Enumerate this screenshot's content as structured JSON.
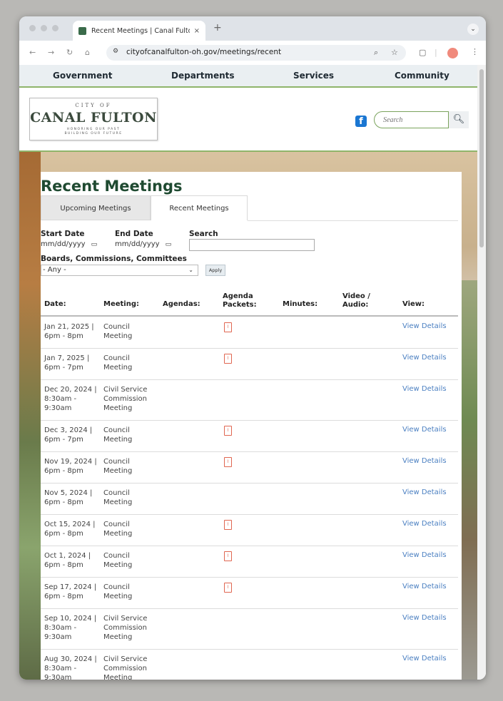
{
  "browser": {
    "tab_title": "Recent Meetings | Canal Fulton",
    "tab_close": "×",
    "new_tab": "+",
    "url": "cityofcanalfulton-oh.gov/meetings/recent"
  },
  "site_nav": {
    "items": [
      "Government",
      "Departments",
      "Services",
      "Community"
    ]
  },
  "header": {
    "logo_top": "CITY OF",
    "logo_name": "CANAL FULTON",
    "logo_tag_1": "HONORING OUR PAST",
    "logo_tag_2": "BUILDING OUR FUTURE",
    "search_placeholder": "Search"
  },
  "page": {
    "title": "Recent Meetings",
    "tabs": [
      {
        "label": "Upcoming Meetings",
        "active": false
      },
      {
        "label": "Recent Meetings",
        "active": true
      }
    ]
  },
  "filters": {
    "start_label": "Start Date",
    "end_label": "End Date",
    "search_label": "Search",
    "date_placeholder": "mm/dd/yyyy",
    "boards_label": "Boards, Commissions, Committees",
    "boards_value": "- Any -",
    "apply_label": "Apply"
  },
  "table": {
    "columns": [
      "Date:",
      "Meeting:",
      "Agendas:",
      "Agenda Packets:",
      "Minutes:",
      "Video / Audio:",
      "View:"
    ],
    "view_label": "View Details",
    "rows": [
      {
        "date": "Jan 21, 2025 | 6pm - 8pm",
        "meeting": "Council Meeting",
        "packet": true
      },
      {
        "date": "Jan 7, 2025 | 6pm - 7pm",
        "meeting": "Council Meeting",
        "packet": true
      },
      {
        "date": "Dec 20, 2024 | 8:30am - 9:30am",
        "meeting": "Civil Service Commission Meeting",
        "packet": false
      },
      {
        "date": "Dec 3, 2024 | 6pm - 7pm",
        "meeting": "Council Meeting",
        "packet": true
      },
      {
        "date": "Nov 19, 2024 | 6pm - 8pm",
        "meeting": "Council Meeting",
        "packet": true
      },
      {
        "date": "Nov 5, 2024 | 6pm - 8pm",
        "meeting": "Council Meeting",
        "packet": false
      },
      {
        "date": "Oct 15, 2024 | 6pm - 8pm",
        "meeting": "Council Meeting",
        "packet": true
      },
      {
        "date": "Oct 1, 2024 | 6pm - 8pm",
        "meeting": "Council Meeting",
        "packet": true
      },
      {
        "date": "Sep 17, 2024 | 6pm - 8pm",
        "meeting": "Council Meeting",
        "packet": true
      },
      {
        "date": "Sep 10, 2024 | 8:30am - 9:30am",
        "meeting": "Civil Service Commission Meeting",
        "packet": false
      },
      {
        "date": "Aug 30, 2024 | 8:30am - 9:30am",
        "meeting": "Civil Service Commission Meeting",
        "packet": false
      }
    ]
  },
  "colors": {
    "title_green": "#1f4a31",
    "accent_green": "#8fb46a",
    "link_blue": "#4a7fc1",
    "pdf_red": "#e06650"
  },
  "icons": {
    "pdf": "pdf-icon",
    "facebook": "facebook-icon",
    "search": "search-icon",
    "calendar": "calendar-icon"
  }
}
